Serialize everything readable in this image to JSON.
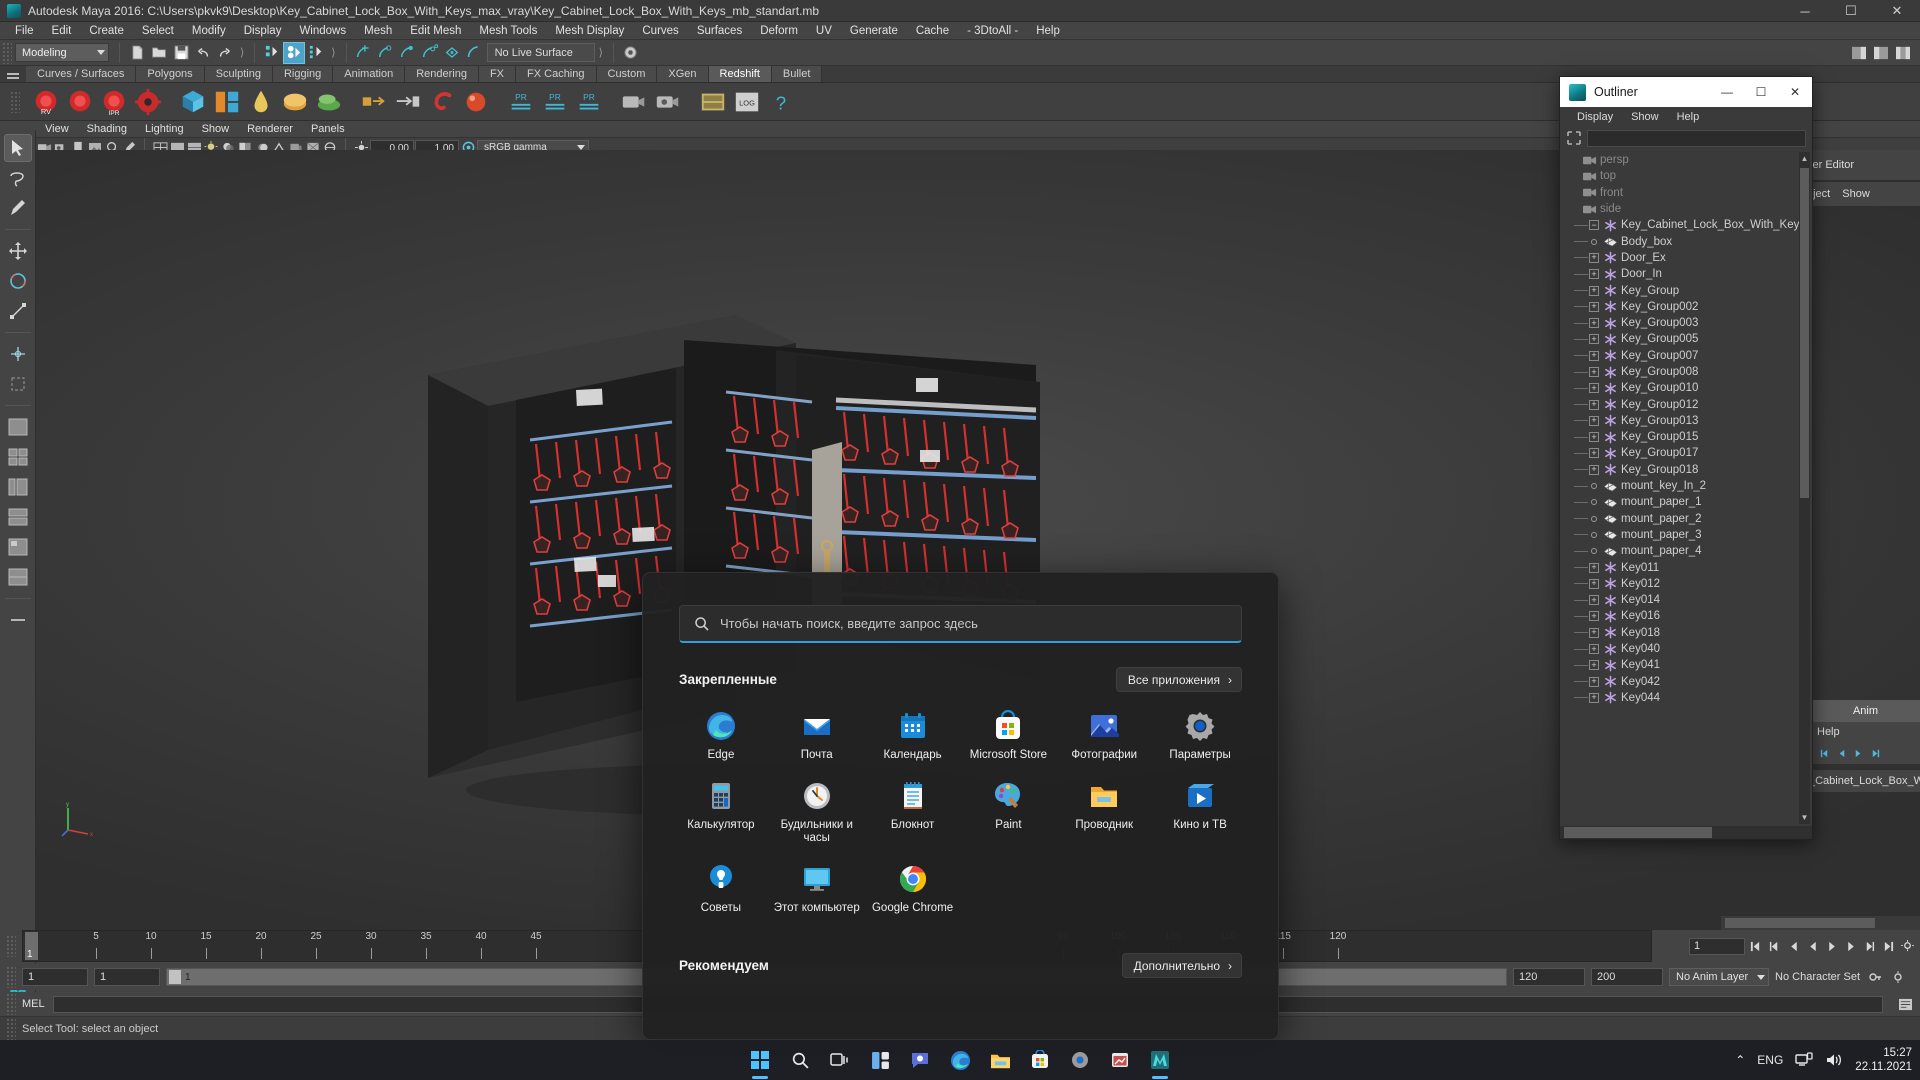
{
  "app": {
    "title": "Autodesk Maya 2016: C:\\Users\\pkvk9\\Desktop\\Key_Cabinet_Lock_Box_With_Keys_max_vray\\Key_Cabinet_Lock_Box_With_Keys_mb_standart.mb",
    "window_controls": {
      "minimize": "─",
      "maximize": "☐",
      "close": "✕"
    }
  },
  "menubar": [
    "File",
    "Edit",
    "Create",
    "Select",
    "Modify",
    "Display",
    "Windows",
    "Mesh",
    "Edit Mesh",
    "Mesh Tools",
    "Mesh Display",
    "Curves",
    "Surfaces",
    "Deform",
    "UV",
    "Generate",
    "Cache",
    "- 3DtoAll -",
    "Help"
  ],
  "toolbar": {
    "mode": "Modeling",
    "live_surface": "No Live Surface"
  },
  "shelf_tabs": [
    {
      "label": "Curves / Surfaces",
      "active": false
    },
    {
      "label": "Polygons",
      "active": false
    },
    {
      "label": "Sculpting",
      "active": false
    },
    {
      "label": "Rigging",
      "active": false
    },
    {
      "label": "Animation",
      "active": false
    },
    {
      "label": "Rendering",
      "active": false
    },
    {
      "label": "FX",
      "active": false
    },
    {
      "label": "FX Caching",
      "active": false
    },
    {
      "label": "Custom",
      "active": false
    },
    {
      "label": "XGen",
      "active": false
    },
    {
      "label": "Redshift",
      "active": true
    },
    {
      "label": "Bullet",
      "active": false
    }
  ],
  "shelf_buttons": [
    "rs-render-view",
    "rs-render",
    "rs-ipr",
    "rs-settings",
    "rs-material",
    "rs-material-grid",
    "rs-sky",
    "rs-dome",
    "rs-env",
    "rs-proxy-out",
    "rs-proxy-in",
    "rs-volume",
    "rs-light-area",
    "rs-light-point",
    "rs-pr-1",
    "rs-pr-2",
    "rs-camera",
    "rs-bokeh",
    "rs-aov",
    "rs-log",
    "rs-help"
  ],
  "viewport_menu": [
    "View",
    "Shading",
    "Lighting",
    "Show",
    "Renderer",
    "Panels"
  ],
  "viewport_toolbar": {
    "exposure": "0.00",
    "gamma": "1.00",
    "color_space": "sRGB gamma"
  },
  "outliner": {
    "window_title": "Outliner",
    "menus": [
      "Display",
      "Show",
      "Help"
    ],
    "search_value": "",
    "search_placeholder": "",
    "items": [
      {
        "label": "persp",
        "icon": "camera-icon",
        "type": "camera",
        "expand": "none",
        "dim": true
      },
      {
        "label": "top",
        "icon": "camera-icon",
        "type": "camera",
        "expand": "none",
        "dim": true
      },
      {
        "label": "front",
        "icon": "camera-icon",
        "type": "camera",
        "expand": "none",
        "dim": true
      },
      {
        "label": "side",
        "icon": "camera-icon",
        "type": "camera",
        "expand": "none",
        "dim": true
      },
      {
        "label": "Key_Cabinet_Lock_Box_With_Keys",
        "icon": "transform-icon",
        "type": "group",
        "expand": "minus",
        "dim": false
      },
      {
        "label": "Body_box",
        "icon": "mesh-icon",
        "type": "mesh",
        "expand": "dot",
        "dim": false
      },
      {
        "label": "Door_Ex",
        "icon": "transform-icon",
        "type": "group",
        "expand": "plus",
        "dim": false
      },
      {
        "label": "Door_In",
        "icon": "transform-icon",
        "type": "group",
        "expand": "plus",
        "dim": false
      },
      {
        "label": "Key_Group",
        "icon": "transform-icon",
        "type": "group",
        "expand": "plus",
        "dim": false
      },
      {
        "label": "Key_Group002",
        "icon": "transform-icon",
        "type": "group",
        "expand": "plus",
        "dim": false
      },
      {
        "label": "Key_Group003",
        "icon": "transform-icon",
        "type": "group",
        "expand": "plus",
        "dim": false
      },
      {
        "label": "Key_Group005",
        "icon": "transform-icon",
        "type": "group",
        "expand": "plus",
        "dim": false
      },
      {
        "label": "Key_Group007",
        "icon": "transform-icon",
        "type": "group",
        "expand": "plus",
        "dim": false
      },
      {
        "label": "Key_Group008",
        "icon": "transform-icon",
        "type": "group",
        "expand": "plus",
        "dim": false
      },
      {
        "label": "Key_Group010",
        "icon": "transform-icon",
        "type": "group",
        "expand": "plus",
        "dim": false
      },
      {
        "label": "Key_Group012",
        "icon": "transform-icon",
        "type": "group",
        "expand": "plus",
        "dim": false
      },
      {
        "label": "Key_Group013",
        "icon": "transform-icon",
        "type": "group",
        "expand": "plus",
        "dim": false
      },
      {
        "label": "Key_Group015",
        "icon": "transform-icon",
        "type": "group",
        "expand": "plus",
        "dim": false
      },
      {
        "label": "Key_Group017",
        "icon": "transform-icon",
        "type": "group",
        "expand": "plus",
        "dim": false
      },
      {
        "label": "Key_Group018",
        "icon": "transform-icon",
        "type": "group",
        "expand": "plus",
        "dim": false
      },
      {
        "label": "mount_key_In_2",
        "icon": "mesh-icon",
        "type": "mesh",
        "expand": "dot",
        "dim": false
      },
      {
        "label": "mount_paper_1",
        "icon": "mesh-icon",
        "type": "mesh",
        "expand": "dot",
        "dim": false
      },
      {
        "label": "mount_paper_2",
        "icon": "mesh-icon",
        "type": "mesh",
        "expand": "dot",
        "dim": false
      },
      {
        "label": "mount_paper_3",
        "icon": "mesh-icon",
        "type": "mesh",
        "expand": "dot",
        "dim": false
      },
      {
        "label": "mount_paper_4",
        "icon": "mesh-icon",
        "type": "mesh",
        "expand": "dot",
        "dim": false
      },
      {
        "label": "Key011",
        "icon": "transform-icon",
        "type": "group",
        "expand": "plus",
        "dim": false
      },
      {
        "label": "Key012",
        "icon": "transform-icon",
        "type": "group",
        "expand": "plus",
        "dim": false
      },
      {
        "label": "Key014",
        "icon": "transform-icon",
        "type": "group",
        "expand": "plus",
        "dim": false
      },
      {
        "label": "Key016",
        "icon": "transform-icon",
        "type": "group",
        "expand": "plus",
        "dim": false
      },
      {
        "label": "Key018",
        "icon": "transform-icon",
        "type": "group",
        "expand": "plus",
        "dim": false
      },
      {
        "label": "Key040",
        "icon": "transform-icon",
        "type": "group",
        "expand": "plus",
        "dim": false
      },
      {
        "label": "Key041",
        "icon": "transform-icon",
        "type": "group",
        "expand": "plus",
        "dim": false
      },
      {
        "label": "Key042",
        "icon": "transform-icon",
        "type": "group",
        "expand": "plus",
        "dim": false
      },
      {
        "label": "Key044",
        "icon": "transform-icon",
        "type": "group",
        "expand": "plus",
        "dim": false
      }
    ]
  },
  "right_panels": {
    "layer_editor": "yer Editor",
    "object_label": "bject",
    "show_label": "Show",
    "anim_tab": "Anim",
    "help_label": "Help",
    "node_name": "_Cabinet_Lock_Box_W"
  },
  "timeline": {
    "ticks": [
      "5",
      "10",
      "15",
      "20",
      "25",
      "30",
      "35",
      "40",
      "45",
      "95",
      "100",
      "105",
      "110",
      "115",
      "120"
    ],
    "current_frame": "1",
    "end_frame_field": "1"
  },
  "range": {
    "start": "1",
    "end": "1",
    "bar_label": "1",
    "range_start": "120",
    "range_end": "200",
    "anim_layer": "No Anim Layer",
    "character_set": "No Character Set"
  },
  "mel": {
    "label": "MEL",
    "command": ""
  },
  "status": {
    "message": "Select Tool: select an object"
  },
  "start_menu": {
    "search_placeholder": "Чтобы начать поиск, введите запрос здесь",
    "pinned_title": "Закрепленные",
    "all_apps_label": "Все приложения",
    "recommended_title": "Рекомендуем",
    "more_label": "Дополнительно",
    "chevron": "›",
    "apps": [
      {
        "name": "Edge",
        "icon": "edge-icon"
      },
      {
        "name": "Почта",
        "icon": "mail-icon"
      },
      {
        "name": "Календарь",
        "icon": "calendar-icon"
      },
      {
        "name": "Microsoft Store",
        "icon": "store-icon"
      },
      {
        "name": "Фотографии",
        "icon": "photos-icon"
      },
      {
        "name": "Параметры",
        "icon": "settings-gear-icon"
      },
      {
        "name": "Калькулятор",
        "icon": "calculator-icon"
      },
      {
        "name": "Будильники и часы",
        "icon": "clock-icon"
      },
      {
        "name": "Блокнот",
        "icon": "notepad-icon"
      },
      {
        "name": "Paint",
        "icon": "paint-palette-icon"
      },
      {
        "name": "Проводник",
        "icon": "folder-icon"
      },
      {
        "name": "Кино и ТВ",
        "icon": "movies-tv-icon"
      },
      {
        "name": "Советы",
        "icon": "tips-bulb-icon"
      },
      {
        "name": "Этот компьютер",
        "icon": "this-pc-icon"
      },
      {
        "name": "Google Chrome",
        "icon": "chrome-icon"
      }
    ]
  },
  "taskbar": {
    "items": [
      "start-icon",
      "search-icon",
      "task-view-icon",
      "widgets-icon",
      "chat-icon",
      "edge-icon",
      "explorer-icon",
      "store-icon",
      "settings-icon",
      "paint-icon",
      "maya-icon"
    ],
    "language": "ENG",
    "time": "15:27",
    "date": "22.11.2021",
    "chevron_up": "⌃"
  },
  "colors": {
    "accent": "#2f9fe0",
    "maya_bg": "#444444",
    "outliner_item": "#cfcfcf",
    "transform_icon": "#b9a0e0",
    "taskbar_bg": "#1c1e24"
  }
}
